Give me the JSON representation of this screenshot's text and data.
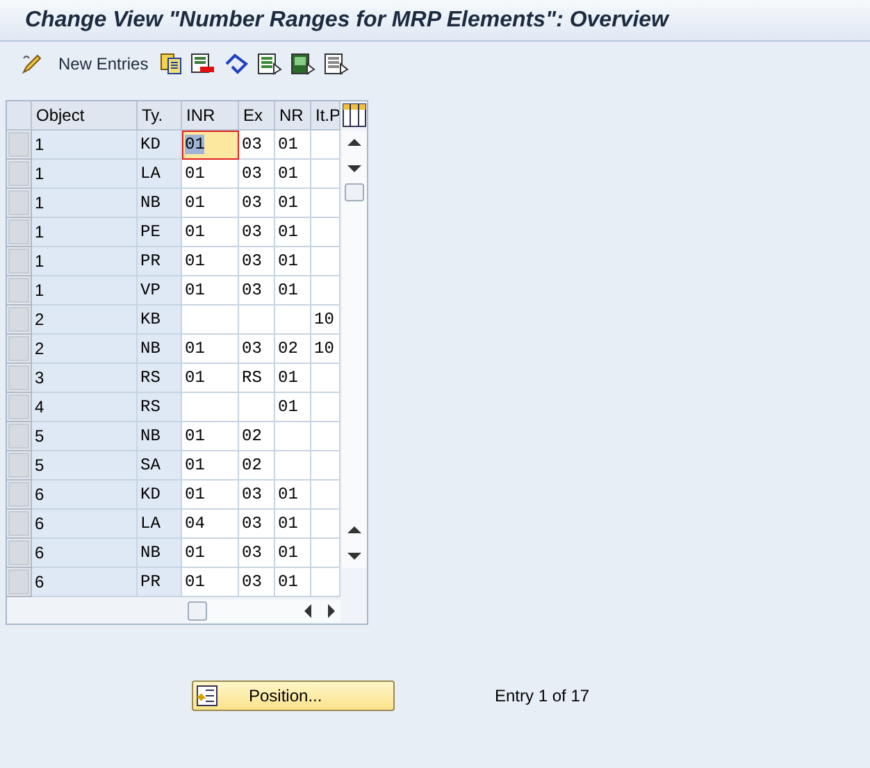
{
  "window": {
    "title": "Change View \"Number Ranges for MRP Elements\": Overview"
  },
  "toolbar": {
    "new_entries": "New Entries"
  },
  "table": {
    "columns": [
      "Object",
      "Ty.",
      "INR",
      "Ex",
      "NR",
      "It.P"
    ],
    "rows": [
      {
        "cells": [
          "1",
          "KD",
          "01",
          "03",
          "01",
          ""
        ],
        "selected": true
      },
      {
        "cells": [
          "1",
          "LA",
          "01",
          "03",
          "01",
          ""
        ],
        "selected": false
      },
      {
        "cells": [
          "1",
          "NB",
          "01",
          "03",
          "01",
          ""
        ],
        "selected": false
      },
      {
        "cells": [
          "1",
          "PE",
          "01",
          "03",
          "01",
          ""
        ],
        "selected": false
      },
      {
        "cells": [
          "1",
          "PR",
          "01",
          "03",
          "01",
          ""
        ],
        "selected": false
      },
      {
        "cells": [
          "1",
          "VP",
          "01",
          "03",
          "01",
          ""
        ],
        "selected": false
      },
      {
        "cells": [
          "2",
          "KB",
          "",
          "",
          "",
          "10"
        ],
        "selected": false
      },
      {
        "cells": [
          "2",
          "NB",
          "01",
          "03",
          "02",
          "10"
        ],
        "selected": false
      },
      {
        "cells": [
          "3",
          "RS",
          "01",
          "RS",
          "01",
          ""
        ],
        "selected": false
      },
      {
        "cells": [
          "4",
          "RS",
          "",
          "",
          "01",
          ""
        ],
        "selected": false
      },
      {
        "cells": [
          "5",
          "NB",
          "01",
          "02",
          "",
          ""
        ],
        "selected": false
      },
      {
        "cells": [
          "5",
          "SA",
          "01",
          "02",
          "",
          ""
        ],
        "selected": false
      },
      {
        "cells": [
          "6",
          "KD",
          "01",
          "03",
          "01",
          ""
        ],
        "selected": false
      },
      {
        "cells": [
          "6",
          "LA",
          "04",
          "03",
          "01",
          ""
        ],
        "selected": false
      },
      {
        "cells": [
          "6",
          "NB",
          "01",
          "03",
          "01",
          ""
        ],
        "selected": false
      },
      {
        "cells": [
          "6",
          "PR",
          "01",
          "03",
          "01",
          ""
        ],
        "selected": false
      }
    ]
  },
  "position_button": "Position...",
  "entry_info": "Entry 1 of 17"
}
